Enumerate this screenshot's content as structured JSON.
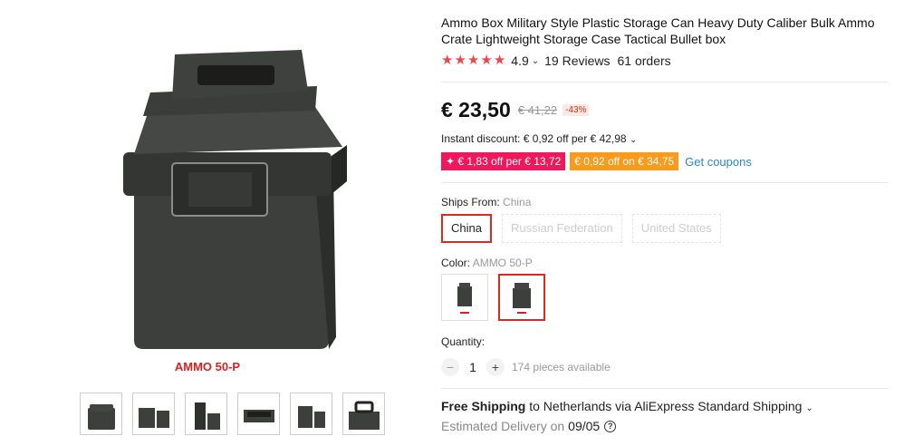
{
  "product": {
    "title": "Ammo Box Military Style Plastic Storage Can Heavy Duty Caliber Bulk Ammo Crate Lightweight Storage Case Tactical Bullet box",
    "image_caption": "AMMO 50-P",
    "rating": "4.9",
    "reviews": "19 Reviews",
    "orders": "61 orders"
  },
  "price": {
    "current": "€ 23,50",
    "original": "€ 41,22",
    "discount": "-43%"
  },
  "promotions": {
    "instant_discount": "Instant discount: € 0,92 off per € 42,98",
    "coupon_1": "✦ € 1,83 off per € 13,72",
    "coupon_2": "€ 0,92 off on € 34,75",
    "get_coupons": "Get coupons"
  },
  "ships_from": {
    "label": "Ships From:",
    "selected": "China",
    "options": [
      "China",
      "Russian Federation",
      "United States"
    ]
  },
  "color": {
    "label": "Color:",
    "selected": "AMMO 50-P"
  },
  "quantity": {
    "label": "Quantity:",
    "value": "1",
    "minus": "−",
    "plus": "+",
    "available": "174 pieces available"
  },
  "shipping": {
    "free": "Free Shipping",
    "rest": " to Netherlands via AliExpress Standard Shipping",
    "estimated_label": "Estimated Delivery on",
    "estimated_date": "09/05"
  },
  "icons": {
    "star": "★",
    "chevron": "⌄",
    "help": "?"
  },
  "colors": {
    "accent_red": "#e0291e",
    "star": "#f0474e",
    "coupon_pink": "#f0185c",
    "coupon_orange": "#f89a1c",
    "link": "#2a87c4"
  }
}
